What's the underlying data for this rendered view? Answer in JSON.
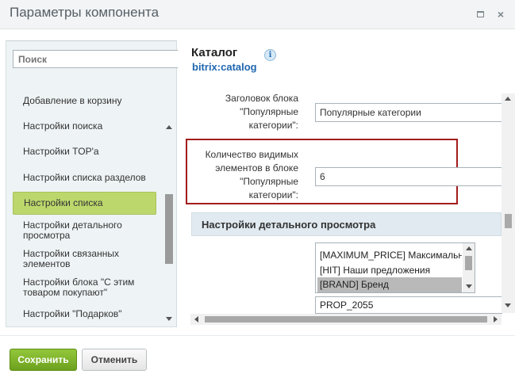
{
  "window": {
    "title": "Параметры компонента",
    "minimize_label": "",
    "close_label": "×"
  },
  "sidebar": {
    "search_placeholder": "Поиск",
    "items": [
      {
        "label": "Добавление в корзину"
      },
      {
        "label": "Настройки поиска"
      },
      {
        "label": "Настройки TOP'a"
      },
      {
        "label": "Настройки списка разделов"
      },
      {
        "label": "Настройки списка"
      },
      {
        "label": "Настройки детального просмотра"
      },
      {
        "label": "Настройки связанных элементов"
      },
      {
        "label": "Настройки блока \"С этим товаром покупают\""
      },
      {
        "label": "Настройки \"Подарков\""
      }
    ],
    "active_index": 4
  },
  "component": {
    "name": "Каталог",
    "code": "bitrix:catalog",
    "info_label": "i"
  },
  "fields": {
    "popular_title_label": "Заголовок блока \"Популярные категории\":",
    "popular_title_value": "Популярные категории",
    "visible_count_label": "Количество видимых элементов в блоке \"Популярные категории\":",
    "visible_count_value": "6"
  },
  "section": {
    "detail_title": "Настройки детального просмотра"
  },
  "multiselect": {
    "options": [
      {
        "label": "[MAXIMUM_PRICE] Максимальная"
      },
      {
        "label": "[HIT] Наши предложения"
      },
      {
        "label": "[BRAND] Бренд"
      }
    ],
    "selected_index": 2
  },
  "prop_field": {
    "value": "PROP_2055"
  },
  "footer": {
    "save_label": "Сохранить",
    "cancel_label": "Отменить"
  },
  "colors": {
    "accent_green": "#7db32a",
    "link_blue": "#2067b0",
    "highlight_red": "#a31c1c",
    "active_item": "#bcd86c"
  }
}
